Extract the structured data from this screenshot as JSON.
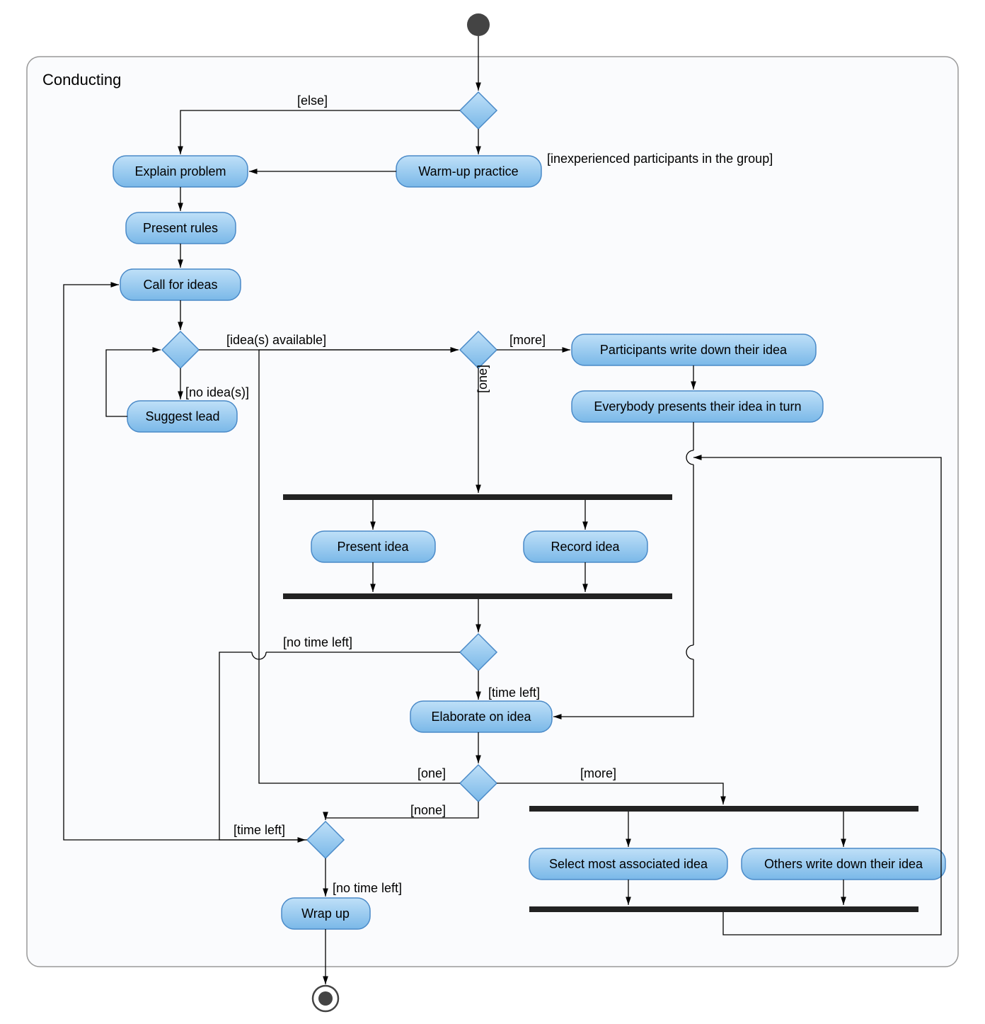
{
  "frame_title": "Conducting",
  "nodes": {
    "explain_problem": "Explain problem",
    "warmup": "Warm-up practice",
    "present_rules": "Present rules",
    "call_for_ideas": "Call for ideas",
    "suggest_lead": "Suggest lead",
    "participants_write": "Participants write down their idea",
    "everybody_presents": "Everybody presents their idea in turn",
    "present_idea": "Present idea",
    "record_idea": "Record idea",
    "elaborate": "Elaborate on idea",
    "select_most": "Select most associated idea",
    "others_write": "Others write down their idea",
    "wrap_up": "Wrap up"
  },
  "guards": {
    "else": "[else]",
    "inexperienced": "[inexperienced participants in the group]",
    "ideas_available": "[idea(s) available]",
    "no_ideas": "[no idea(s)]",
    "more1": "[more]",
    "one1": "[one]",
    "no_time_left1": "[no time left]",
    "time_left1": "[time left]",
    "more2": "[more]",
    "one2": "[one]",
    "none": "[none]",
    "time_left2": "[time left]",
    "no_time_left2": "[no time left]"
  },
  "chart_data": {
    "type": "activity-diagram",
    "frame": "Conducting",
    "initial_node": "start",
    "final_node": "end",
    "actions": [
      "Explain problem",
      "Warm-up practice",
      "Present rules",
      "Call for ideas",
      "Suggest lead",
      "Participants write down their idea",
      "Everybody presents their idea in turn",
      "Present idea",
      "Record idea",
      "Elaborate on idea",
      "Select most associated idea",
      "Others write down their idea",
      "Wrap up"
    ],
    "decisions": [
      "d1",
      "d2",
      "d3",
      "d4",
      "d5",
      "d6"
    ],
    "forks": [
      "fork1",
      "fork2"
    ],
    "joins": [
      "join1",
      "join2"
    ],
    "edges": [
      {
        "from": "start",
        "to": "d1"
      },
      {
        "from": "d1",
        "to": "Explain problem",
        "guard": "[else]"
      },
      {
        "from": "d1",
        "to": "Warm-up practice",
        "guard": "[inexperienced participants in the group]"
      },
      {
        "from": "Warm-up practice",
        "to": "Explain problem"
      },
      {
        "from": "Explain problem",
        "to": "Present rules"
      },
      {
        "from": "Present rules",
        "to": "Call for ideas"
      },
      {
        "from": "Call for ideas",
        "to": "d2"
      },
      {
        "from": "d2",
        "to": "d3",
        "guard": "[idea(s) available]"
      },
      {
        "from": "d2",
        "to": "Suggest lead",
        "guard": "[no idea(s)]"
      },
      {
        "from": "Suggest lead",
        "to": "d2"
      },
      {
        "from": "d3",
        "to": "Participants write down their idea",
        "guard": "[more]"
      },
      {
        "from": "Participants write down their idea",
        "to": "Everybody presents their idea in turn"
      },
      {
        "from": "Everybody presents their idea in turn",
        "to": "Elaborate on idea"
      },
      {
        "from": "d3",
        "to": "fork1",
        "guard": "[one]"
      },
      {
        "from": "fork1",
        "to": "Present idea"
      },
      {
        "from": "fork1",
        "to": "Record idea"
      },
      {
        "from": "Present idea",
        "to": "join1"
      },
      {
        "from": "Record idea",
        "to": "join1"
      },
      {
        "from": "join1",
        "to": "d4"
      },
      {
        "from": "d4",
        "to": "Elaborate on idea",
        "guard": "[time left]"
      },
      {
        "from": "d4",
        "to": "d6",
        "guard": "[no time left]"
      },
      {
        "from": "Elaborate on idea",
        "to": "d5"
      },
      {
        "from": "d5",
        "to": "fork2",
        "guard": "[more]"
      },
      {
        "from": "fork2",
        "to": "Select most associated idea"
      },
      {
        "from": "fork2",
        "to": "Others write down their idea"
      },
      {
        "from": "Select most associated idea",
        "to": "join2"
      },
      {
        "from": "Others write down their idea",
        "to": "join2"
      },
      {
        "from": "join2",
        "to": "Elaborate on idea"
      },
      {
        "from": "d5",
        "to": "d3",
        "guard": "[one]"
      },
      {
        "from": "d5",
        "to": "d6",
        "guard": "[none]"
      },
      {
        "from": "d6",
        "to": "Call for ideas",
        "guard": "[time left]"
      },
      {
        "from": "d6",
        "to": "Wrap up",
        "guard": "[no time left]"
      },
      {
        "from": "Wrap up",
        "to": "end"
      }
    ]
  }
}
